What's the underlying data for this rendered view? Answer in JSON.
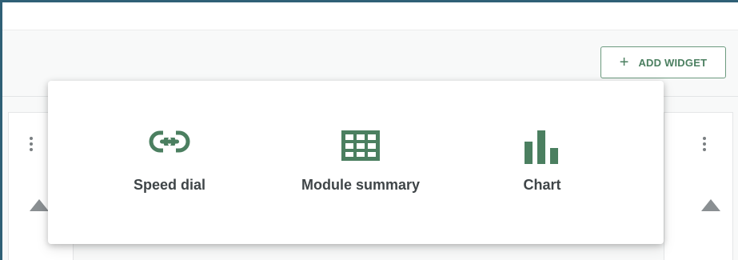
{
  "toolbar": {
    "add_widget_label": "ADD WIDGET",
    "add_widget_icon": "plus-icon"
  },
  "widget_picker": {
    "options": [
      {
        "label": "Speed dial",
        "icon": "link-icon"
      },
      {
        "label": "Module summary",
        "icon": "grid-icon"
      },
      {
        "label": "Chart",
        "icon": "bar-chart-icon"
      }
    ]
  },
  "colors": {
    "accent_green": "#4b7f60",
    "frame_border": "#2f6076",
    "text_dark": "#3f4548"
  }
}
